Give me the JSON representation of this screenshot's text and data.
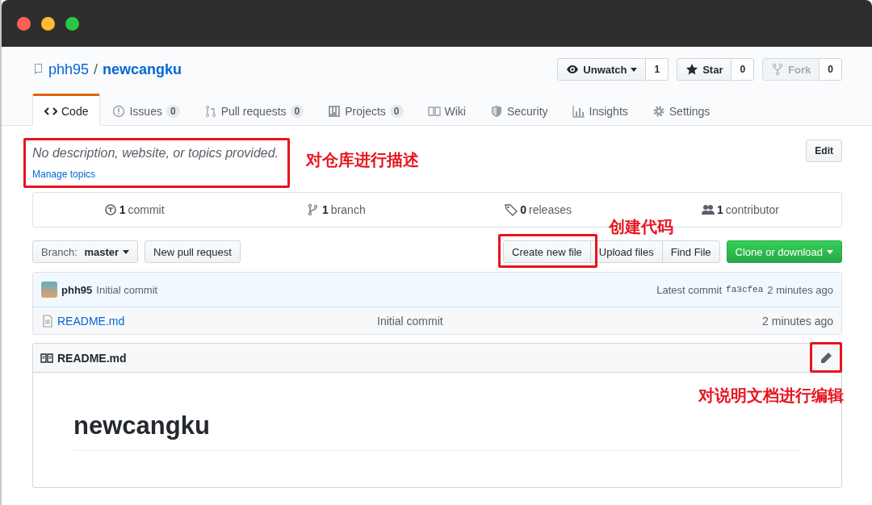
{
  "repo": {
    "owner": "phh95",
    "separator": "/",
    "name": "newcangku"
  },
  "actions": [
    {
      "kind": "watch",
      "label": "Unwatch",
      "count": "1",
      "disabled": false
    },
    {
      "kind": "star",
      "label": "Star",
      "count": "0",
      "disabled": false
    },
    {
      "kind": "fork",
      "label": "Fork",
      "count": "0",
      "disabled": true
    }
  ],
  "tabs": [
    {
      "kind": "code",
      "label": "Code",
      "selected": true
    },
    {
      "kind": "issues",
      "label": "Issues",
      "count": "0",
      "selected": false
    },
    {
      "kind": "pulls",
      "label": "Pull requests",
      "count": "0",
      "selected": false
    },
    {
      "kind": "projects",
      "label": "Projects",
      "count": "0",
      "selected": false
    },
    {
      "kind": "wiki",
      "label": "Wiki",
      "selected": false
    },
    {
      "kind": "security",
      "label": "Security",
      "selected": false
    },
    {
      "kind": "insights",
      "label": "Insights",
      "selected": false
    },
    {
      "kind": "settings",
      "label": "Settings",
      "selected": false
    }
  ],
  "description": {
    "text": "No description, website, or topics provided.",
    "link": "Manage topics",
    "edit_button": "Edit"
  },
  "summary": [
    {
      "kind": "commits",
      "count": "1",
      "label": "commit"
    },
    {
      "kind": "branches",
      "count": "1",
      "label": "branch"
    },
    {
      "kind": "releases",
      "count": "0",
      "label": "releases"
    },
    {
      "kind": "contributors",
      "count": "1",
      "label": "contributor"
    }
  ],
  "toolbar": {
    "branch_prefix": "Branch:",
    "branch": "master",
    "pull_request_button": "New pull request",
    "file_buttons": [
      "Create new file",
      "Upload files",
      "Find File"
    ],
    "clone_button": "Clone or download"
  },
  "commit": {
    "author": "phh95",
    "message": "Initial commit",
    "latest_label": "Latest commit",
    "sha": "fa3cfea",
    "time": "2 minutes ago"
  },
  "files": [
    {
      "name": "README.md",
      "message": "Initial commit",
      "time": "2 minutes ago"
    }
  ],
  "readme": {
    "title": "README.md",
    "heading": "newcangku"
  },
  "annotations": [
    {
      "text": "对仓库进行描述"
    },
    {
      "text": "创建代码"
    },
    {
      "text": "对说明文档进行编辑"
    }
  ]
}
